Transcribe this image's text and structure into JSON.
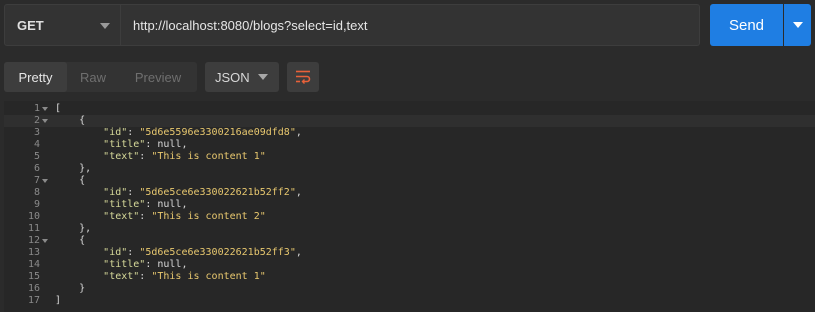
{
  "request": {
    "method": "GET",
    "url": "http://localhost:8080/blogs?select=id,text",
    "send_label": "Send"
  },
  "response": {
    "view_tabs": [
      "Pretty",
      "Raw",
      "Preview"
    ],
    "active_tab": "Pretty",
    "format": "JSON"
  },
  "colors": {
    "accent": "#1f7ee3",
    "wrap_icon": "#e8613a",
    "json_key": "#d7da9a",
    "json_string": "#e8c86f"
  },
  "icons": {
    "method_caret": "chevron-down-icon",
    "send_caret": "chevron-down-icon",
    "format_caret": "chevron-down-icon",
    "wrap": "wrap-lines-icon",
    "fold": "fold-triangle-icon"
  },
  "code": {
    "lines": [
      {
        "n": "1",
        "fold": true,
        "text": "["
      },
      {
        "n": "2",
        "fold": true,
        "text": "    {"
      },
      {
        "n": "3",
        "fold": false,
        "key": "\"id\"",
        "sep": ": ",
        "val": "\"5d6e5596e3300216ae09dfd8\"",
        "end": ",",
        "indent": "        "
      },
      {
        "n": "4",
        "fold": false,
        "key": "\"title\"",
        "sep": ": ",
        "val": "null",
        "end": ",",
        "indent": "        ",
        "isNull": true
      },
      {
        "n": "5",
        "fold": false,
        "key": "\"text\"",
        "sep": ": ",
        "val": "\"This is content 1\"",
        "end": "",
        "indent": "        "
      },
      {
        "n": "6",
        "fold": false,
        "text": "    },"
      },
      {
        "n": "7",
        "fold": true,
        "text": "    {"
      },
      {
        "n": "8",
        "fold": false,
        "key": "\"id\"",
        "sep": ": ",
        "val": "\"5d6e5ce6e330022621b52ff2\"",
        "end": ",",
        "indent": "        "
      },
      {
        "n": "9",
        "fold": false,
        "key": "\"title\"",
        "sep": ": ",
        "val": "null",
        "end": ",",
        "indent": "        ",
        "isNull": true
      },
      {
        "n": "10",
        "fold": false,
        "key": "\"text\"",
        "sep": ": ",
        "val": "\"This is content 2\"",
        "end": "",
        "indent": "        "
      },
      {
        "n": "11",
        "fold": false,
        "text": "    },"
      },
      {
        "n": "12",
        "fold": true,
        "text": "    {"
      },
      {
        "n": "13",
        "fold": false,
        "key": "\"id\"",
        "sep": ": ",
        "val": "\"5d6e5ce6e330022621b52ff3\"",
        "end": ",",
        "indent": "        "
      },
      {
        "n": "14",
        "fold": false,
        "key": "\"title\"",
        "sep": ": ",
        "val": "null",
        "end": ",",
        "indent": "        ",
        "isNull": true
      },
      {
        "n": "15",
        "fold": false,
        "key": "\"text\"",
        "sep": ": ",
        "val": "\"This is content 1\"",
        "end": "",
        "indent": "        "
      },
      {
        "n": "16",
        "fold": false,
        "text": "    }"
      },
      {
        "n": "17",
        "fold": false,
        "text": "]"
      }
    ]
  }
}
